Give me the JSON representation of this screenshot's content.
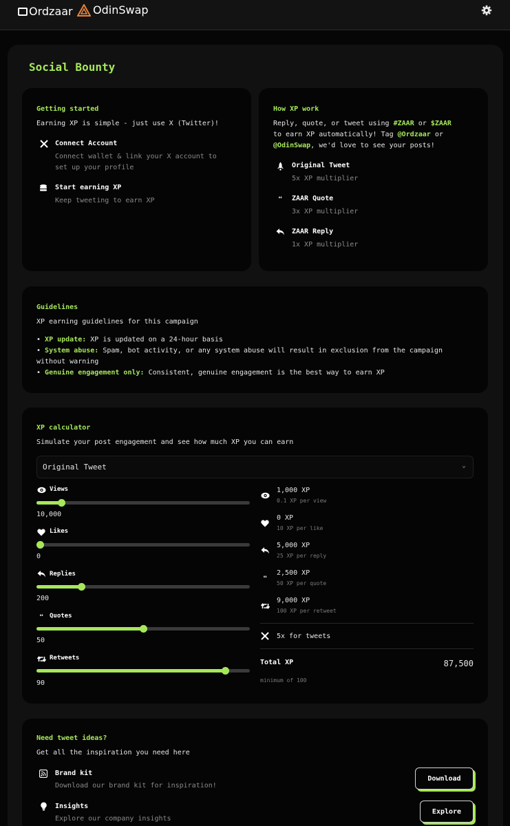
{
  "header": {
    "brand_ordzaar": "Ordzaar",
    "brand_odinswap": "OdinSwap"
  },
  "page": {
    "title": "Social Bounty"
  },
  "getting_started": {
    "title": "Getting started",
    "intro": "Earning XP is simple - just use X (Twitter)!",
    "steps": [
      {
        "icon": "x-logo-icon",
        "title": "Connect Account",
        "desc_line1": "Connect wallet & link your X account to",
        "desc_line2": "set up your profile"
      },
      {
        "icon": "coins-icon",
        "title": "Start earning XP",
        "desc_line1": "Keep tweeting to earn XP"
      }
    ]
  },
  "how_xp": {
    "title": "How XP work",
    "line1_pre": "Reply, quote, or tweet using ",
    "line1_tag1": "#ZAAR",
    "line1_mid": " or ",
    "line1_tag2": "$ZAAR",
    "line2": "to earn XP automatically! Tag ",
    "line2_tag": "@Ordzaar",
    "line2_post": " or",
    "line3_tag": "@OdinSwap",
    "line3_post": ", we'd love to see your posts!",
    "items": [
      {
        "icon": "rocket-icon",
        "title": "Original Tweet",
        "desc": "5x XP multiplier"
      },
      {
        "icon": "quote-icon",
        "title": "ZAAR Quote",
        "desc": "3x XP multiplier"
      },
      {
        "icon": "reply-icon",
        "title": "ZAAR Reply",
        "desc": "1x XP multiplier"
      }
    ]
  },
  "guidelines": {
    "title": "Guidelines",
    "intro": "XP earning guidelines for this campaign",
    "items": [
      {
        "label": "XP update:",
        "text": " XP is updated on a 24-hour basis"
      },
      {
        "label": "System abuse:",
        "text": " Spam, bot activity, or any system abuse will result in exclusion from the campaign",
        "text2": "without warning"
      },
      {
        "label": "Genuine engagement only:",
        "text": " Consistent, genuine engagement is the best way to earn XP"
      }
    ]
  },
  "calculator": {
    "title": "XP calculator",
    "intro": "Simulate your post engagement and see how much XP you can earn",
    "select_value": "Original Tweet",
    "sliders": [
      {
        "icon": "eye-icon",
        "label": "Views",
        "value": "10,000",
        "fraction": 0.115
      },
      {
        "icon": "heart-icon",
        "label": "Likes",
        "value": "0",
        "fraction": 0.015
      },
      {
        "icon": "reply-icon",
        "label": "Replies",
        "value": "200",
        "fraction": 0.21
      },
      {
        "icon": "quote-icon",
        "label": "Quotes",
        "value": "50",
        "fraction": 0.5
      },
      {
        "icon": "retweet-icon",
        "label": "Retweets",
        "value": "90",
        "fraction": 0.885
      }
    ],
    "results": [
      {
        "icon": "eye-icon",
        "xp": "1,000 XP",
        "rate": "0.1 XP per view"
      },
      {
        "icon": "heart-icon",
        "xp": "0 XP",
        "rate": "10 XP per like"
      },
      {
        "icon": "reply-icon",
        "xp": "5,000 XP",
        "rate": "25 XP per reply"
      },
      {
        "icon": "quote-icon",
        "xp": "2,500 XP",
        "rate": "50 XP per quote"
      },
      {
        "icon": "retweet-icon",
        "xp": "9,000 XP",
        "rate": "100 XP per retweet"
      }
    ],
    "multiplier": "5x for tweets",
    "total_label": "Total XP",
    "total_value": "87,500",
    "minimum": "minimum of 100"
  },
  "ideas": {
    "title": "Need tweet ideas?",
    "intro": "Get all the inspiration you need here",
    "items": [
      {
        "icon": "rss-icon",
        "title": "Brand kit",
        "desc": "Download our brand kit for inspiration!",
        "button": "Download"
      },
      {
        "icon": "lightbulb-icon",
        "title": "Insights",
        "desc": "Explore our company insights",
        "button": "Explore"
      }
    ]
  },
  "colors": {
    "accent": "#a6e75a",
    "background": "#060606",
    "card": "#050505",
    "panel": "#111111"
  }
}
